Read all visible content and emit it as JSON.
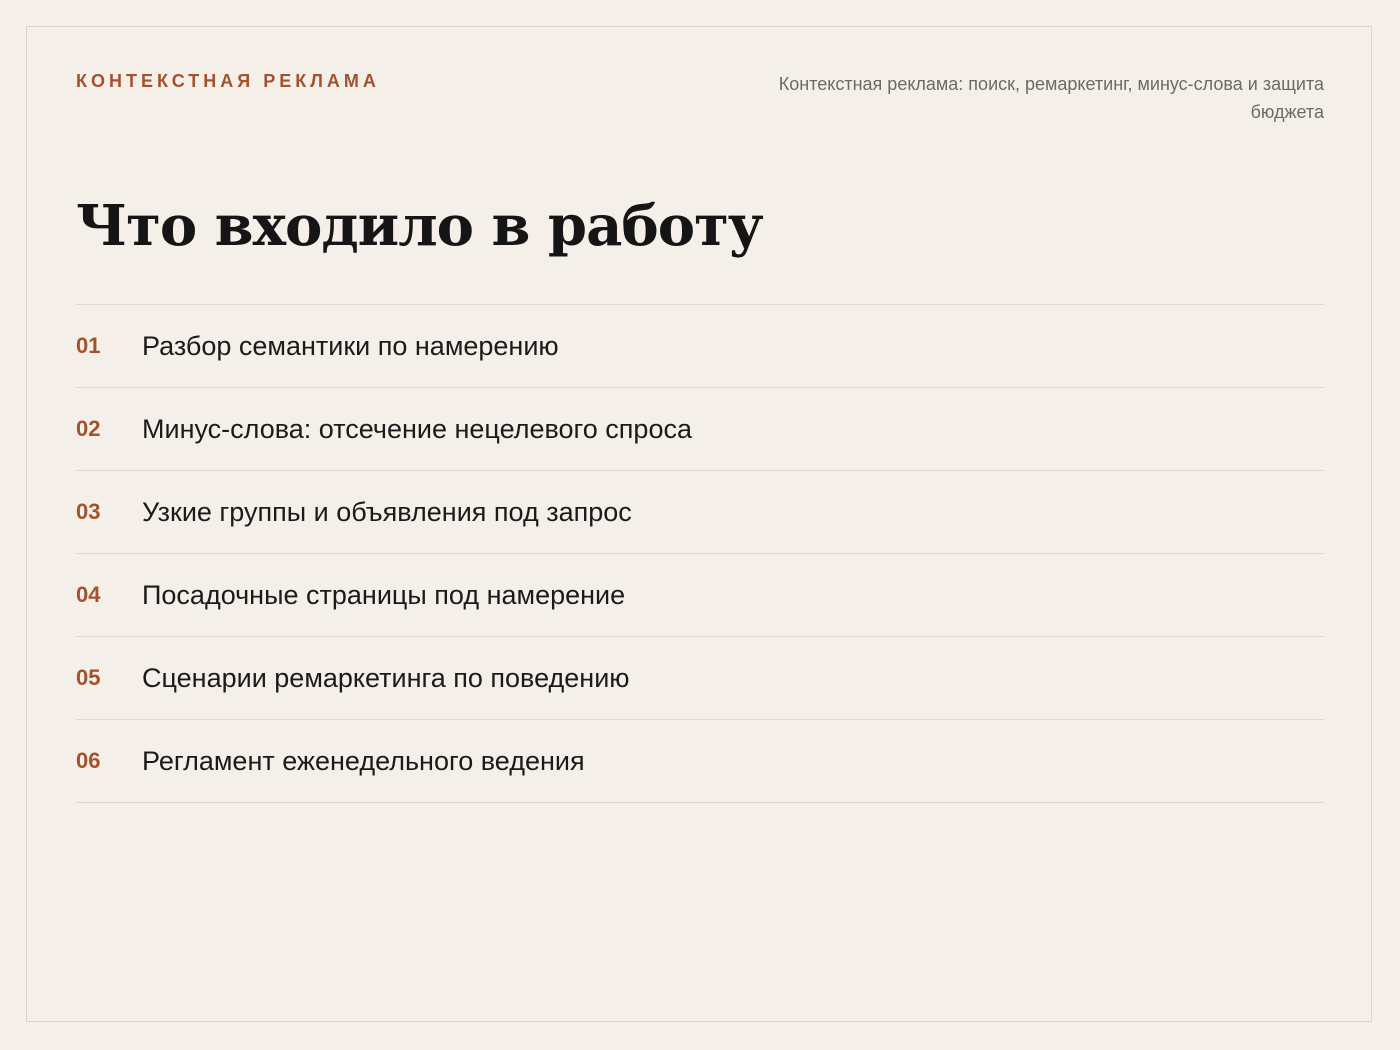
{
  "header": {
    "eyebrow": "КОНТЕКСТНАЯ РЕКЛАМА",
    "subtitle": "Контекстная реклама: поиск, ремаркетинг, минус-слова и защита бюджета"
  },
  "main": {
    "title": "Что входило в работу",
    "items": [
      {
        "num": "01",
        "text": "Разбор семантики по намерению"
      },
      {
        "num": "02",
        "text": "Минус-слова: отсечение нецелевого спроса"
      },
      {
        "num": "03",
        "text": "Узкие группы и объявления под запрос"
      },
      {
        "num": "04",
        "text": "Посадочные страницы под намерение"
      },
      {
        "num": "05",
        "text": "Сценарии ремаркетинга по поведению"
      },
      {
        "num": "06",
        "text": "Регламент еженедельного ведения"
      }
    ]
  },
  "colors": {
    "background": "#f4efe9",
    "accent": "#a2532e",
    "text": "#1b1b1b",
    "muted": "#6d6a66",
    "divider": "#dcd7d1"
  }
}
